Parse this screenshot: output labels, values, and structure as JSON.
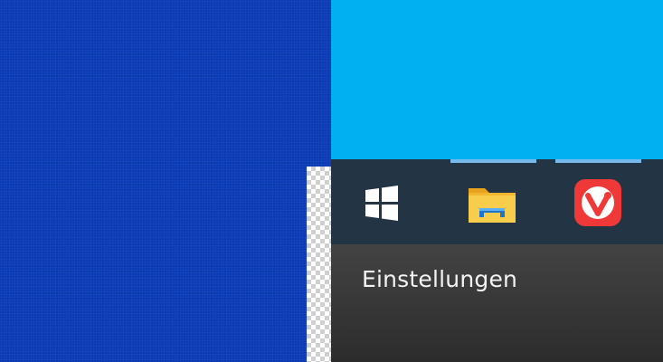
{
  "desktop": {
    "left_color": "#0b3bb6",
    "right_color": "#00b0f0"
  },
  "taskbar": {
    "background": "#233445",
    "accent": "#76b9ed",
    "items": [
      {
        "name": "start-button",
        "icon": "windows-logo-icon"
      },
      {
        "name": "file-explorer-button",
        "icon": "folder-icon"
      },
      {
        "name": "vivaldi-button",
        "icon": "vivaldi-icon"
      }
    ]
  },
  "tooltip": {
    "label": "Einstellungen"
  }
}
